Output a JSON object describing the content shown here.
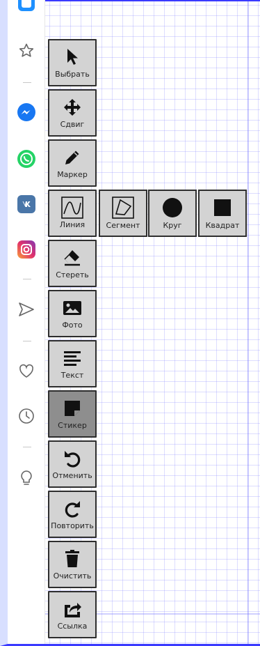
{
  "rail": {
    "icons": [
      "square-app-icon",
      "star-icon",
      "messenger-icon",
      "whatsapp-icon",
      "vk-icon",
      "instagram-icon",
      "send-icon",
      "heart-icon",
      "clock-icon",
      "lightbulb-icon"
    ],
    "colors": {
      "messenger": "#1877f2",
      "whatsapp": "#25d366",
      "vk": "#4a76a8",
      "instagram": "#e1306c",
      "accent": "#1e90ff"
    }
  },
  "tools": [
    {
      "label": "Выбрать",
      "icon": "cursor-icon"
    },
    {
      "label": "Сдвиг",
      "icon": "move-icon"
    },
    {
      "label": "Маркер",
      "icon": "pencil-icon"
    },
    {
      "label": "Линия",
      "icon": "line-icon"
    },
    {
      "label": "Стереть",
      "icon": "eraser-icon"
    },
    {
      "label": "Фото",
      "icon": "image-icon"
    },
    {
      "label": "Текст",
      "icon": "text-icon"
    },
    {
      "label": "Стикер",
      "icon": "sticker-icon",
      "active": true
    },
    {
      "label": "Отменить",
      "icon": "undo-icon"
    },
    {
      "label": "Повторить",
      "icon": "redo-icon"
    },
    {
      "label": "Очистить",
      "icon": "trash-icon"
    },
    {
      "label": "Ссылка",
      "icon": "share-icon"
    }
  ],
  "line_submenu": [
    {
      "label": "Сегмент",
      "icon": "segment-icon"
    },
    {
      "label": "Круг",
      "icon": "circle-icon"
    },
    {
      "label": "Квадрат",
      "icon": "square-icon"
    }
  ]
}
